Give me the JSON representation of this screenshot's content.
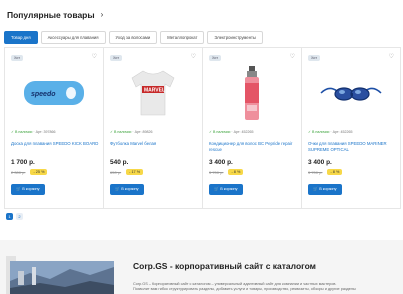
{
  "section": {
    "title": "Популярные товары",
    "chevron_icon": "chevron-right-icon"
  },
  "tabs": [
    {
      "label": "Товар дня",
      "active": true
    },
    {
      "label": "Аксессуары для плавания",
      "active": false
    },
    {
      "label": "Уход за волосами",
      "active": false
    },
    {
      "label": "Металлопрокат",
      "active": false
    },
    {
      "label": "Электроинструменты",
      "active": false
    }
  ],
  "products": [
    {
      "badge": "Хит",
      "stock": "✓ В наличии",
      "article": "Арт: 397866",
      "name": "Доска для плавания SPEEDO KICK BOARD",
      "price": "1 700 р.",
      "old_price": "2 300 р.",
      "discount": "- 25 %",
      "cart_label": "В корзину",
      "image": "kickboard",
      "color": "#5ab0e8"
    },
    {
      "badge": "Хит",
      "stock": "✓ В наличии",
      "article": "Арт: 89826",
      "name": "Футболка Marvel белая",
      "price": "540 р.",
      "old_price": "650 р.",
      "discount": "- 17 %",
      "cart_label": "В корзину",
      "image": "tshirt",
      "color": "#e8e8e8"
    },
    {
      "badge": "Хит",
      "stock": "✓ В наличии",
      "article": "Арт: 452265",
      "name": "Кондиционер для волос BC Pepride repair rescue",
      "price": "3 400 р.",
      "old_price": "3 700 р.",
      "discount": "- 8 %",
      "cart_label": "В корзину",
      "image": "bottle",
      "color": "#e45566"
    },
    {
      "badge": "Хит",
      "stock": "✓ В наличии",
      "article": "Арт: 452265",
      "name": "Очки для плавания SPEEDO MARINER SUPREME OPTICAL",
      "price": "3 400 р.",
      "old_price": "3 700 р.",
      "discount": "- 8 %",
      "cart_label": "В корзину",
      "image": "goggles",
      "color": "#1d4fa6"
    }
  ],
  "pager": [
    "1",
    "2"
  ],
  "about": {
    "title": "Corp.GS - корпоративный сайт с каталогом",
    "text1": "Corp.GS – Корпоративный сайт с каталогом – универсальный адаптивный сайт для компании и частных мастеров.",
    "text2": "Позволит вам гибко структурировать разделы, добавить услуги и товары, производство, реквизиты, обзоры и другие разделы"
  }
}
